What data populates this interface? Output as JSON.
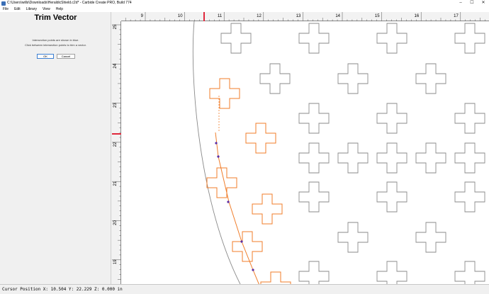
{
  "window": {
    "title": "C:\\Users\\wills\\Downloads\\HeraldicShield.c2d* - Carbide Create PRO, Build 774",
    "minimize": "–",
    "maximize": "☐",
    "close": "✕"
  },
  "menu": {
    "items": [
      {
        "label": "File"
      },
      {
        "label": "Edit"
      },
      {
        "label": "Library"
      },
      {
        "label": "View"
      },
      {
        "label": "Help"
      }
    ]
  },
  "panel": {
    "title": "Trim Vector",
    "message_line1": "Intersection points are shown in blue.",
    "message_line2": "Click between intersection points to trim a vector.",
    "ok_label": "OK",
    "cancel_label": "Cancel"
  },
  "ruler": {
    "x_labels": [
      "9",
      "10",
      "11",
      "12",
      "13",
      "14",
      "15",
      "16",
      "17"
    ],
    "y_labels": [
      "25",
      "24",
      "23",
      "22",
      "21",
      "20",
      "19"
    ]
  },
  "status": {
    "cursor_position": "Cursor Position X: 10.504 Y: 22.229 Z: 0.000 in"
  },
  "colors": {
    "selected_vector": "#f07d2a",
    "intersection_point": "#5a2ea6",
    "unselected_vector": "#8a8a8a",
    "cursor_marker": "#e0283c"
  }
}
